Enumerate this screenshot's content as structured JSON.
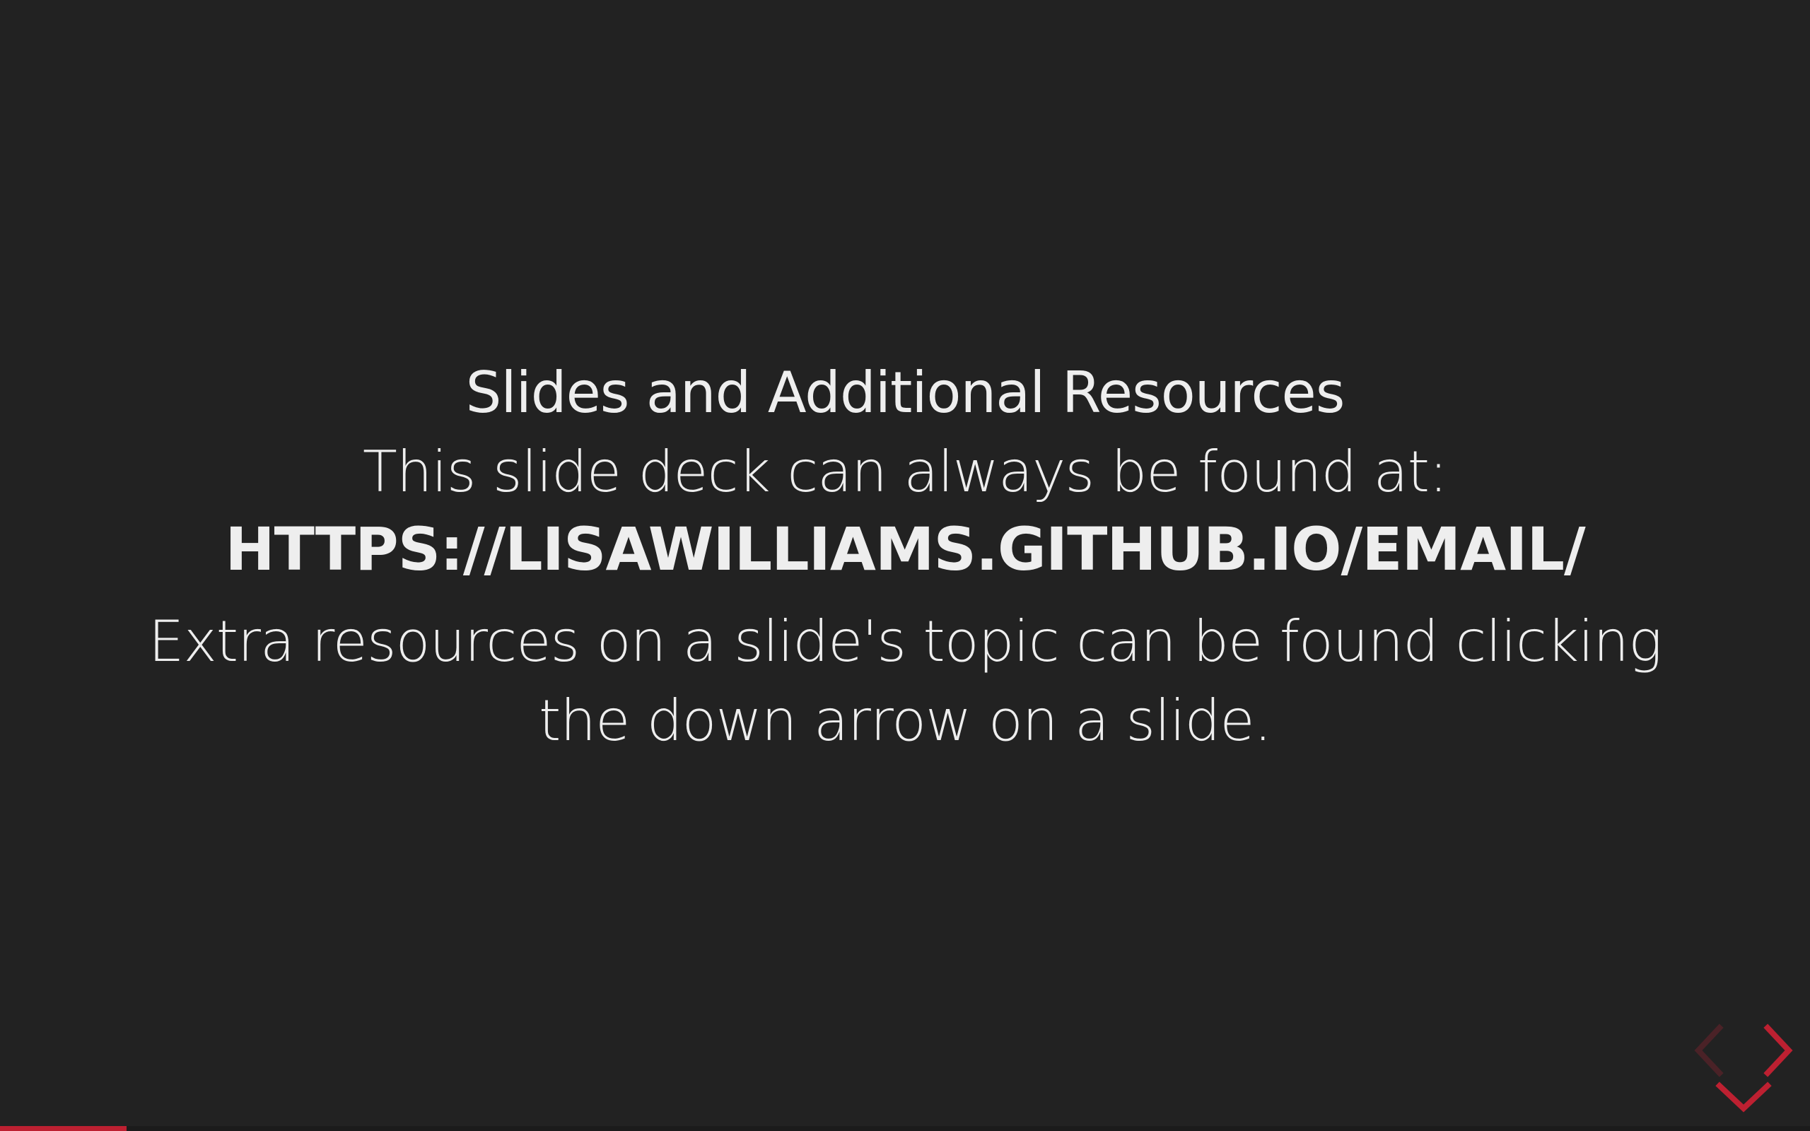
{
  "slide": {
    "title": "Slides and Additional Resources",
    "line": "This slide deck can always be found at:",
    "url": "HTTPS://LISAWILLIAMS.GITHUB.IO/EMAIL/",
    "note": "Extra resources on a slide's topic can be found clicking the down arrow on a slide."
  },
  "controls": {
    "left_icon": "chevron-left-icon",
    "right_icon": "chevron-right-icon",
    "down_icon": "chevron-down-icon",
    "left_enabled": false,
    "right_enabled": true,
    "down_enabled": true
  },
  "progress": {
    "fraction": 0.07
  },
  "colors": {
    "background": "#222222",
    "text": "#eeeeee",
    "accent": "#bd2031",
    "accent_disabled": "#4a2227"
  }
}
